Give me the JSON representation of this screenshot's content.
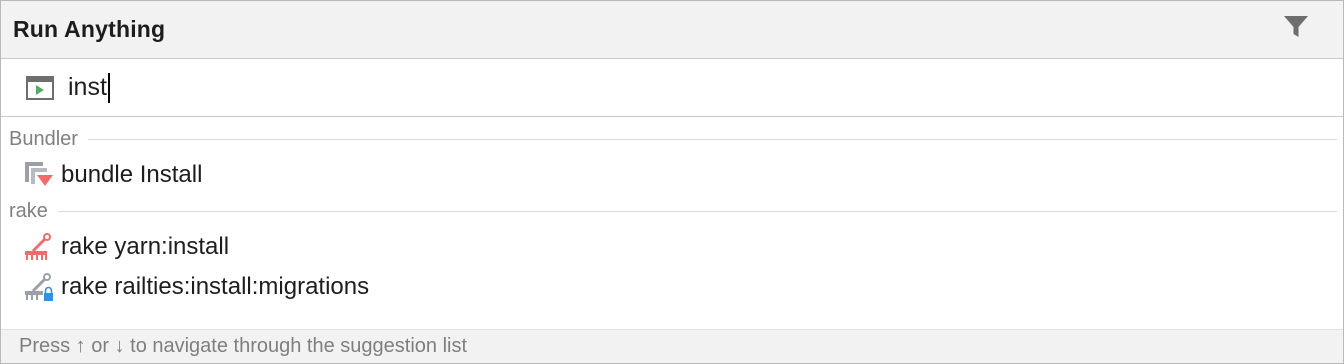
{
  "header": {
    "title": "Run Anything",
    "filter_icon": "filter-icon"
  },
  "search": {
    "icon": "run-terminal-icon",
    "value": "inst"
  },
  "groups": [
    {
      "label": "Bundler",
      "items": [
        {
          "label": "bundle Install",
          "icon": "bundler-icon"
        }
      ]
    },
    {
      "label": "rake",
      "items": [
        {
          "label": "rake yarn:install",
          "icon": "rake-icon"
        },
        {
          "label": "rake railties:install:migrations",
          "icon": "rake-locked-icon"
        }
      ]
    }
  ],
  "footer": {
    "hint": "Press ↑ or ↓ to navigate through the suggestion list"
  },
  "colors": {
    "header_bg": "#f2f2f2",
    "border": "#c9c9c9",
    "group_label": "#808080",
    "rake_red": "#f26b6b",
    "run_green": "#59a869",
    "lock_blue": "#3a8fd6"
  }
}
